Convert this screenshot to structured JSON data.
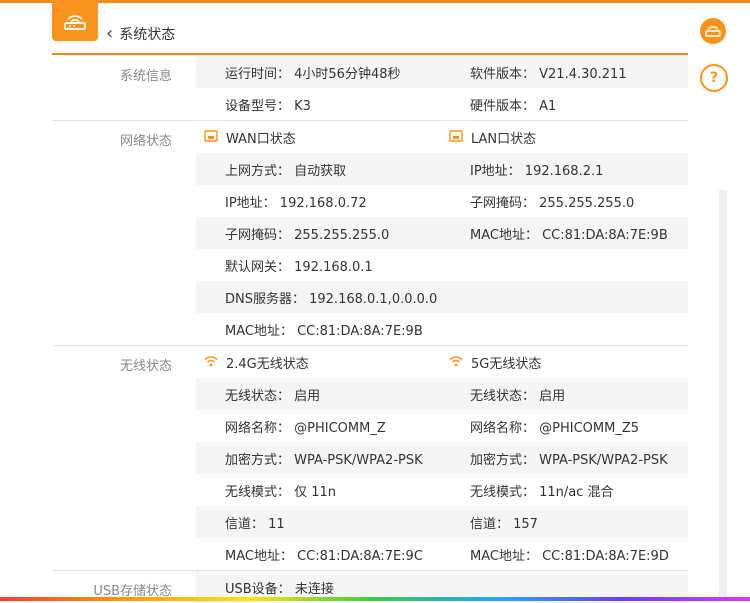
{
  "header": {
    "title": "系统状态"
  },
  "sections": {
    "system": {
      "label": "系统信息",
      "rows": [
        [
          "运行时间：  4小时56分钟48秒",
          "软件版本：  V21.4.30.211"
        ],
        [
          "设备型号：  K3",
          "硬件版本：  A1"
        ]
      ]
    },
    "network": {
      "label": "网络状态",
      "wan_title": "WAN口状态",
      "lan_title": "LAN口状态",
      "rows": [
        [
          "上网方式：  自动获取",
          "IP地址：  192.168.2.1"
        ],
        [
          "IP地址：  192.168.0.72",
          "子网掩码：  255.255.255.0"
        ],
        [
          "子网掩码：  255.255.255.0",
          "MAC地址：  CC:81:DA:8A:7E:9B"
        ],
        [
          "默认网关：  192.168.0.1",
          ""
        ],
        [
          "DNS服务器：  192.168.0.1,0.0.0.0",
          ""
        ],
        [
          "MAC地址：  CC:81:DA:8A:7E:9B",
          ""
        ]
      ]
    },
    "wireless": {
      "label": "无线状态",
      "band24_title": "2.4G无线状态",
      "band5_title": "5G无线状态",
      "rows": [
        [
          "无线状态：  启用",
          "无线状态：  启用"
        ],
        [
          "网络名称：  @PHICOMM_Z",
          "网络名称：  @PHICOMM_Z5"
        ],
        [
          "加密方式：  WPA-PSK/WPA2-PSK",
          "加密方式：  WPA-PSK/WPA2-PSK"
        ],
        [
          "无线模式：  仅 11n",
          "无线模式：  11n/ac 混合"
        ],
        [
          "信道：  11",
          "信道：  157"
        ],
        [
          "MAC地址：  CC:81:DA:8A:7E:9C",
          "MAC地址：  CC:81:DA:8A:7E:9D"
        ]
      ]
    },
    "usb": {
      "label": "USB存储状态",
      "rows": [
        [
          "USB设备：  未连接",
          ""
        ]
      ]
    }
  },
  "icons": {
    "logo": "router-icon",
    "side_router": "router-icon",
    "side_help": "help-icon",
    "wan": "port-icon",
    "lan": "port-icon",
    "wifi": "wifi-icon"
  },
  "colors": {
    "accent": "#f7941d",
    "row_alt": "#f5f5f5",
    "label": "#888888"
  }
}
